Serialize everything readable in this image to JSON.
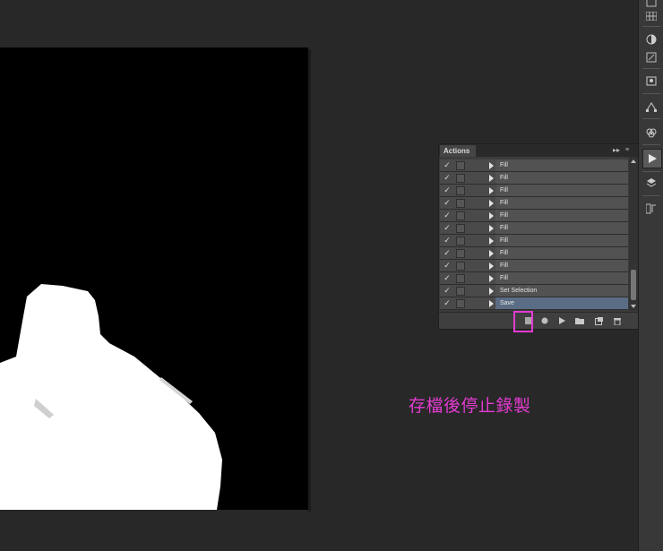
{
  "panel": {
    "tab_label": "Actions",
    "collapse_glyph": "▸▸",
    "menu_glyph": "≡"
  },
  "actions": [
    {
      "label": "Fill",
      "checked": true,
      "selected": false
    },
    {
      "label": "Fill",
      "checked": true,
      "selected": false
    },
    {
      "label": "Fill",
      "checked": true,
      "selected": false
    },
    {
      "label": "Fill",
      "checked": true,
      "selected": false
    },
    {
      "label": "Fill",
      "checked": true,
      "selected": false
    },
    {
      "label": "Fill",
      "checked": true,
      "selected": false
    },
    {
      "label": "Fill",
      "checked": true,
      "selected": false
    },
    {
      "label": "Fill",
      "checked": true,
      "selected": false
    },
    {
      "label": "Fill",
      "checked": true,
      "selected": false
    },
    {
      "label": "Fill",
      "checked": true,
      "selected": false
    },
    {
      "label": "Set Selection",
      "checked": true,
      "selected": false
    },
    {
      "label": "Save",
      "checked": true,
      "selected": true
    }
  ],
  "footer_buttons": [
    "stop-recording-icon",
    "record-icon",
    "play-icon",
    "new-set-folder-icon",
    "new-action-icon",
    "delete-icon"
  ],
  "caption": "存檔後停止錄製",
  "colors": {
    "highlight": "#e43bd1",
    "selected_row": "#5b6d84"
  }
}
